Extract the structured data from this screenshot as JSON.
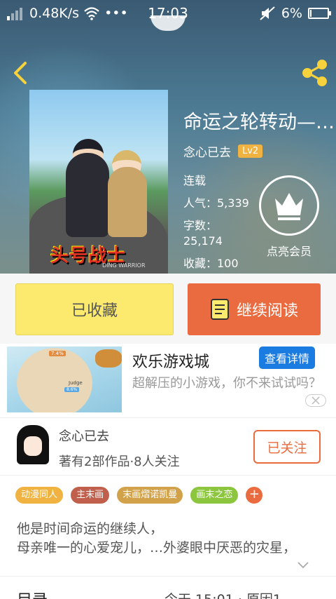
{
  "status_bar": {
    "speed": "0.48K/s",
    "more": "•••",
    "time": "17:03",
    "battery": "6%",
    "battery_level": 0.06
  },
  "header": {
    "back_icon": "chevron-left-icon",
    "share_icon": "share-icon"
  },
  "book": {
    "title": "命运之轮转动—…",
    "author": "念心已去",
    "level": "Lv2",
    "status": "连载",
    "popularity": "人气：5,339",
    "word_count_label": "字数：",
    "word_count_value": "25,174",
    "favorites": "收藏：100",
    "cover_logo": "头号战士",
    "cover_logo_sub": "DING WARRIOR"
  },
  "vip": {
    "label": "点亮会员",
    "icon": "crown-icon"
  },
  "actions": {
    "favorited_label": "已收藏",
    "continue_label": "继续阅读",
    "continue_icon": "book-icon"
  },
  "ad": {
    "title": "欢乐游戏城",
    "details_label": "查看详情",
    "description": "超解压的小游戏，你不来试试吗？",
    "image_tags": [
      "7.4%",
      "8.6%",
      "Judge"
    ],
    "close_icon": "close-icon"
  },
  "author_card": {
    "name": "念心已去",
    "summary": "著有2部作品·8人关注",
    "follow_label": "已关注"
  },
  "tags": {
    "items": [
      {
        "label": "动漫同人",
        "color": "#f0b341"
      },
      {
        "label": "主末画",
        "color": "#c0604c"
      },
      {
        "label": "末画熠诺凯曼",
        "color": "#d2a24a"
      },
      {
        "label": "画末之恋",
        "color": "#8cc63f"
      }
    ],
    "add_label": "+"
  },
  "description": {
    "line1": "他是时间命运的继续人，",
    "line2": "母亲唯一的心爱宠儿，…外婆眼中厌恶的灾星，"
  },
  "toc": {
    "title": "目录",
    "meta": "今天 15:01 · 原因1…"
  },
  "colors": {
    "accent_orange": "#ea6b3f",
    "fav_yellow": "#fbea6d",
    "ad_blue": "#1a7be0",
    "level_badge": "#f0b341"
  }
}
